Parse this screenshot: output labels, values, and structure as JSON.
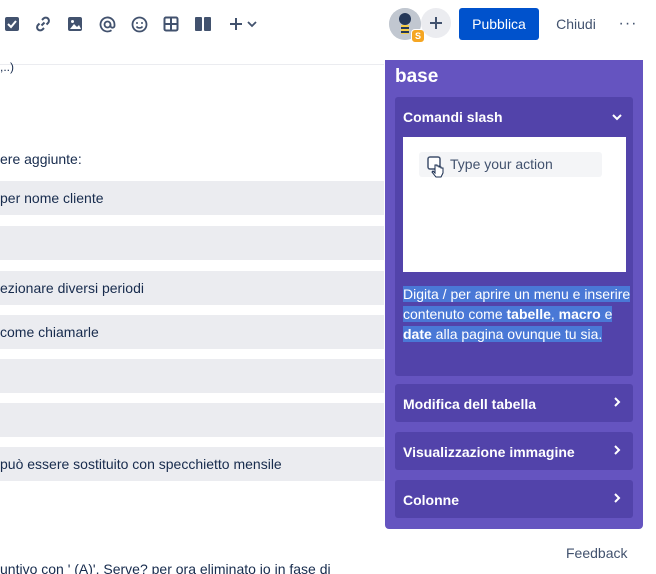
{
  "toolbar": {
    "icons": [
      "checkbox-icon",
      "link-icon",
      "image-icon",
      "mention-icon",
      "emoji-icon",
      "table-icon",
      "layout-icon",
      "insert-plus-icon"
    ],
    "publish_label": "Pubblica",
    "close_label": "Chiudi",
    "more_label": "···",
    "avatar_badge": "S"
  },
  "document": {
    "top_fragment": ",..)",
    "intro": "ere aggiunte:",
    "rows": [
      "per nome cliente",
      "",
      "ezionare diversi periodi",
      "come chiamarle",
      "",
      "",
      "può essere sostituito con specchietto mensile"
    ],
    "bottom_fragment": "untivo con ' (A)'. Serve? per ora eliminato io in fase di"
  },
  "panel": {
    "title": "base",
    "slash_card": {
      "title": "Comandi slash",
      "preview_placeholder": "Type your action",
      "desc_1": "Digita / per aprire un menu e inserire contenuto come ",
      "desc_b1": "tabelle",
      "desc_2": ", ",
      "desc_b2": "macro",
      "desc_3": " e ",
      "desc_b3": "date",
      "desc_4": " alla pagina ovunque tu sia."
    },
    "cards": [
      "Modifica dell tabella",
      "Visualizzazione immagine",
      "Colonne"
    ]
  },
  "feedback_label": "Feedback"
}
